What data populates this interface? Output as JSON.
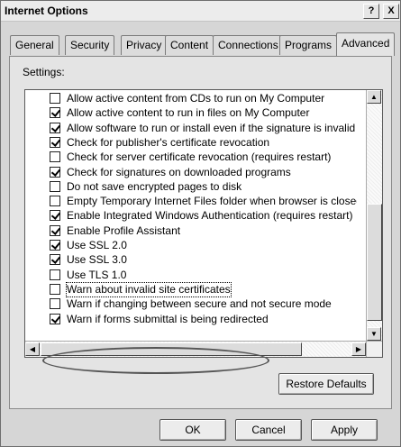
{
  "window": {
    "title": "Internet Options",
    "help_glyph": "?",
    "close_glyph": "X"
  },
  "tabs": [
    {
      "label": "General"
    },
    {
      "label": "Security"
    },
    {
      "label": "Privacy"
    },
    {
      "label": "Content"
    },
    {
      "label": "Connections"
    },
    {
      "label": "Programs"
    },
    {
      "label": "Advanced",
      "active": true
    }
  ],
  "settings": {
    "label": "Settings:",
    "items": [
      {
        "label": "Allow active content from CDs to run on My Computer",
        "checked": false
      },
      {
        "label": "Allow active content to run in files on My Computer",
        "checked": true
      },
      {
        "label": "Allow software to run or install even if the signature is invalid",
        "checked": true
      },
      {
        "label": "Check for publisher's certificate revocation",
        "checked": true
      },
      {
        "label": "Check for server certificate revocation (requires restart)",
        "checked": false
      },
      {
        "label": "Check for signatures on downloaded programs",
        "checked": true
      },
      {
        "label": "Do not save encrypted pages to disk",
        "checked": false
      },
      {
        "label": "Empty Temporary Internet Files folder when browser is closed",
        "checked": false
      },
      {
        "label": "Enable Integrated Windows Authentication (requires restart)",
        "checked": true
      },
      {
        "label": "Enable Profile Assistant",
        "checked": true
      },
      {
        "label": "Use SSL 2.0",
        "checked": true
      },
      {
        "label": "Use SSL 3.0",
        "checked": true
      },
      {
        "label": "Use TLS 1.0",
        "checked": false
      },
      {
        "label": "Warn about invalid site certificates",
        "checked": false,
        "focused": true
      },
      {
        "label": "Warn if changing between secure and not secure mode",
        "checked": false
      },
      {
        "label": "Warn if forms submittal is being redirected",
        "checked": true
      }
    ]
  },
  "buttons": {
    "restore_defaults": "Restore Defaults",
    "ok": "OK",
    "cancel": "Cancel",
    "apply": "Apply"
  }
}
